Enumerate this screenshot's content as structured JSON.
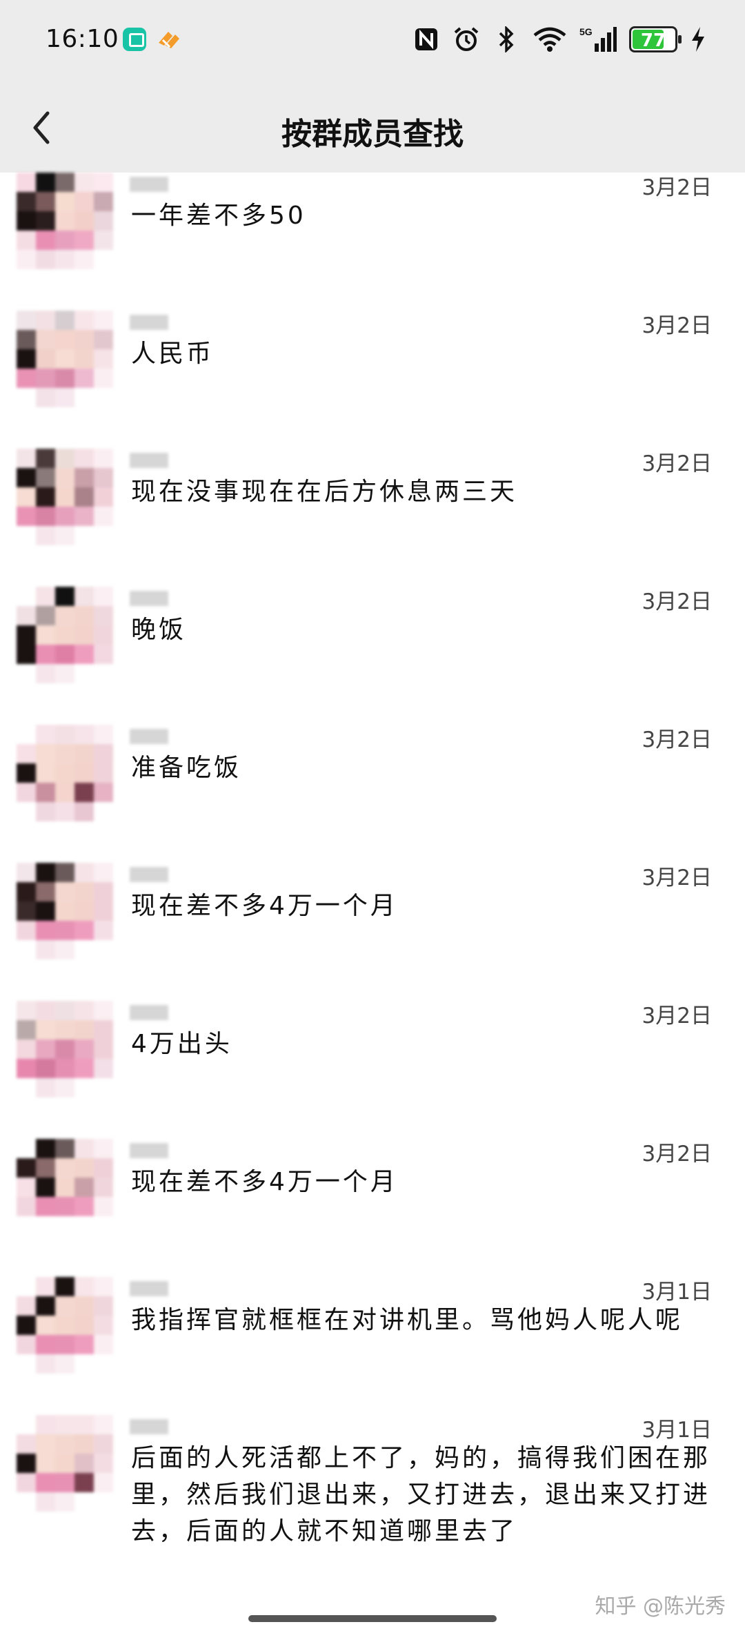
{
  "status_bar": {
    "time": "16:10",
    "battery": "77",
    "battery_level": 0.77,
    "icons": [
      "nfc-icon",
      "alarm-icon",
      "bluetooth-icon",
      "wifi-icon",
      "signal-5g-icon",
      "battery-icon",
      "charging-icon"
    ]
  },
  "header": {
    "title": "按群成员查找",
    "back_icon": "chevron-left-icon"
  },
  "messages": [
    {
      "date": "3月2日",
      "text": "一年差不多50"
    },
    {
      "date": "3月2日",
      "text": "人民币"
    },
    {
      "date": "3月2日",
      "text": "现在没事现在在后方休息两三天"
    },
    {
      "date": "3月2日",
      "text": "晚饭"
    },
    {
      "date": "3月2日",
      "text": "准备吃饭"
    },
    {
      "date": "3月2日",
      "text": "现在差不多4万一个月"
    },
    {
      "date": "3月2日",
      "text": "4万出头"
    },
    {
      "date": "3月2日",
      "text": "现在差不多4万一个月"
    },
    {
      "date": "3月1日",
      "text": "我指挥官就框框在对讲机里。骂他妈人呢人呢"
    },
    {
      "date": "3月1日",
      "text": "后面的人死活都上不了，妈的，搞得我们困在那里，然后我们退出来，又打进去，退出来又打进去，后面的人就不知道哪里去了"
    }
  ],
  "watermark": "知乎 @陈光秀",
  "colors": {
    "bar_bg": "#ececec",
    "battery_green": "#2fc53a",
    "avatar_pink": "#f2a7c4"
  }
}
